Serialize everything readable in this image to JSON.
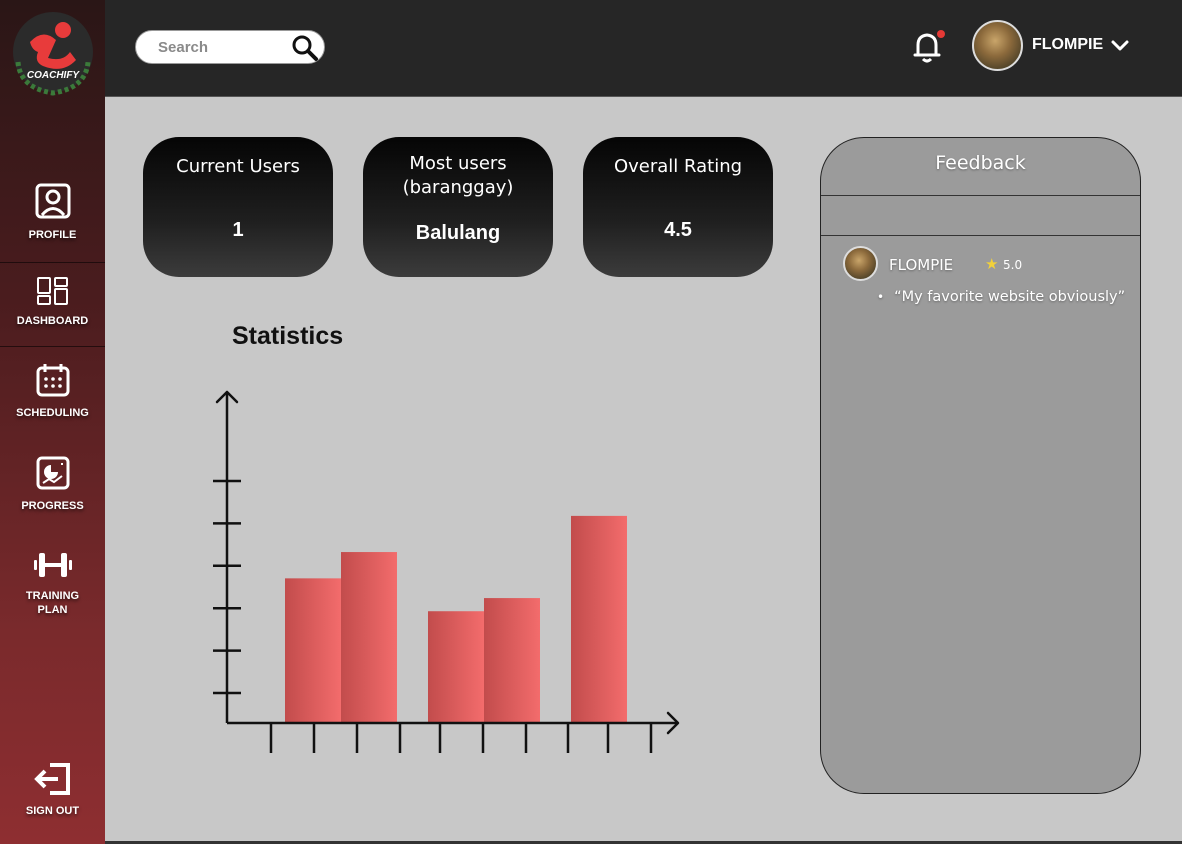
{
  "brand": {
    "name": "COACHIFY"
  },
  "sidebar": {
    "items": [
      {
        "label": "PROFILE",
        "icon": "profile-icon"
      },
      {
        "label": "DASHBOARD",
        "icon": "dashboard-icon"
      },
      {
        "label": "SCHEDULING",
        "icon": "calendar-icon"
      },
      {
        "label": "PROGRESS",
        "icon": "progress-icon"
      },
      {
        "label": "TRAINING PLAN",
        "icon": "dumbbell-icon"
      }
    ],
    "signout": {
      "label": "SIGN OUT",
      "icon": "signout-icon"
    }
  },
  "header": {
    "search_placeholder": "Search",
    "username": "FLOMPIE",
    "notification_dot_color": "#e53935"
  },
  "stats": {
    "cards": [
      {
        "title": "Current Users",
        "value": "1"
      },
      {
        "title": "Most users (baranggay)",
        "value": "Balulang"
      },
      {
        "title": "Overall Rating",
        "value": "4.5"
      }
    ],
    "title": "Statistics"
  },
  "chart_data": {
    "type": "bar",
    "title": "Statistics",
    "xlabel": "",
    "ylabel": "",
    "groups": [
      {
        "values": [
          4.4,
          5.2
        ]
      },
      {
        "values": [
          3.4,
          3.8
        ]
      },
      {
        "values": [
          6.3
        ]
      }
    ],
    "ylim": [
      0,
      8
    ],
    "y_ticks": 6,
    "x_ticks": 10,
    "bar_color": "#f06a6a"
  },
  "feedback": {
    "title": "Feedback",
    "entries": [
      {
        "name": "FLOMPIE",
        "rating": "5.0",
        "comment": "“My favorite website obviously”"
      }
    ]
  }
}
